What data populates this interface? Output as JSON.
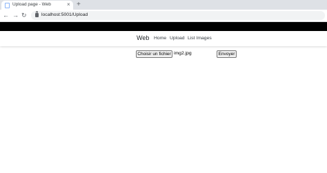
{
  "browser": {
    "tab_title": "Upload page - Web",
    "close_glyph": "×",
    "new_tab_glyph": "+",
    "back_glyph": "←",
    "forward_glyph": "→",
    "reload_glyph": "↻",
    "url": "localhost:5001/Upload"
  },
  "navbar": {
    "brand": "Web",
    "links": [
      "Home",
      "Upload",
      "List Images"
    ]
  },
  "form": {
    "file_button": "Choisir un fichier",
    "file_name": "img2.jpg",
    "submit": "Envoyer"
  }
}
